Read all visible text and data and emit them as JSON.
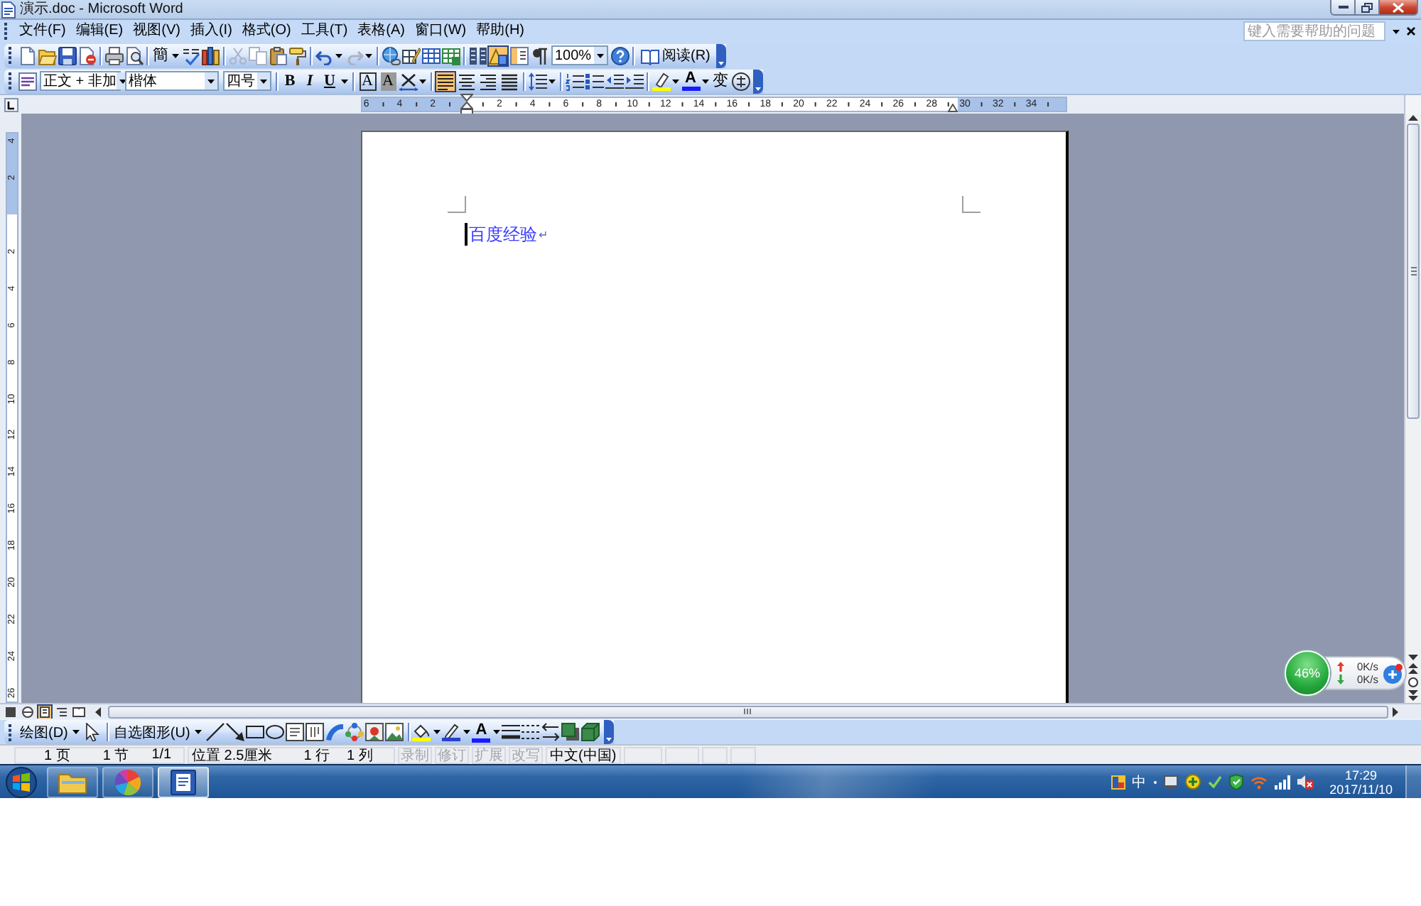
{
  "window": {
    "title": "演示.doc - Microsoft Word"
  },
  "menu_bar": {
    "items": [
      "文件(F)",
      "编辑(E)",
      "视图(V)",
      "插入(I)",
      "格式(O)",
      "工具(T)",
      "表格(A)",
      "窗口(W)",
      "帮助(H)"
    ],
    "help_search": {
      "placeholder": "键入需要帮助的问题"
    }
  },
  "standard_toolbar": {
    "convert_button": "簡",
    "drawing_button": {
      "pressed": true
    },
    "zoom": "100%",
    "read_button": "阅读(R)"
  },
  "formatting_toolbar": {
    "style": "正文 + 非加",
    "font": "楷体",
    "size": "四号",
    "bold": "B",
    "italic": "I",
    "underline": "U",
    "character_border": "A",
    "character_shading": "A",
    "alignment": [
      {
        "selected": true
      },
      {
        "selected": false
      },
      {
        "selected": false
      },
      {
        "selected": false
      }
    ],
    "font_color": "A",
    "phonetic_guide": "变"
  },
  "horizontal_ruler": {
    "left_labels": [
      "6",
      "4",
      "2"
    ],
    "labels": [
      "2",
      "4",
      "6",
      "8",
      "10",
      "12",
      "14",
      "16",
      "18",
      "20",
      "22",
      "24",
      "26",
      "28",
      "30",
      "32",
      "34"
    ]
  },
  "vertical_ruler": {
    "top_labels": [
      "4",
      "2"
    ],
    "labels": [
      "2",
      "4",
      "6",
      "8",
      "10",
      "12",
      "14",
      "16",
      "18",
      "20",
      "22",
      "24",
      "26"
    ]
  },
  "document": {
    "text": "百度经验",
    "paragraph_mark": "↵"
  },
  "view_buttons": [
    {
      "selected": false
    },
    {
      "selected": false
    },
    {
      "selected": true
    },
    {
      "selected": false
    },
    {
      "selected": false
    }
  ],
  "drawing_toolbar": {
    "draw_menu": "绘图(D)",
    "autoshapes_menu": "自选图形(U)",
    "font_color": "A"
  },
  "status_bar": {
    "page": "1 页",
    "section": "1 节",
    "page_of": "1/1",
    "position": "位置 2.5厘米",
    "line": "1 行",
    "column": "1 列",
    "modes": [
      {
        "label": "录制",
        "active": false
      },
      {
        "label": "修订",
        "active": false
      },
      {
        "label": "扩展",
        "active": false
      },
      {
        "label": "改写",
        "active": false
      }
    ],
    "language": "中文(中国)"
  },
  "taskbar": {
    "apps": [
      {
        "selected": false
      },
      {
        "selected": false
      },
      {
        "selected": true
      }
    ],
    "ime": "中",
    "time": "17:29",
    "date": "2017/11/10"
  },
  "speed_widget": {
    "percent": "46%",
    "upload": "0K/s",
    "download": "0K/s"
  }
}
